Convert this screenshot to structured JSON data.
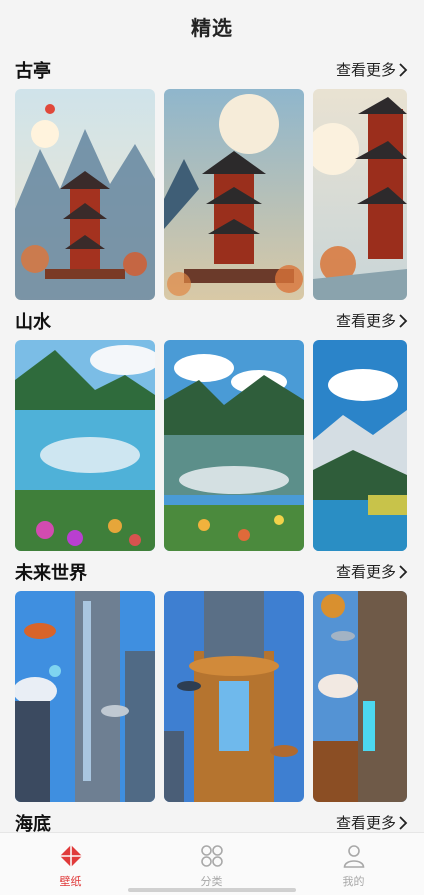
{
  "header": {
    "title": "精选"
  },
  "sections": [
    {
      "title": "古亭",
      "more": "查看更多"
    },
    {
      "title": "山水",
      "more": "查看更多"
    },
    {
      "title": "未来世界",
      "more": "查看更多"
    },
    {
      "title": "海底",
      "more": "查看更多"
    }
  ],
  "tabbar": {
    "tabs": [
      {
        "label": "壁纸",
        "icon": "wallpaper-icon",
        "active": true
      },
      {
        "label": "分类",
        "icon": "category-icon",
        "active": false
      },
      {
        "label": "我的",
        "icon": "profile-icon",
        "active": false
      }
    ]
  },
  "colors": {
    "accent": "#e03a3a",
    "inactive": "#a8a8a8"
  }
}
